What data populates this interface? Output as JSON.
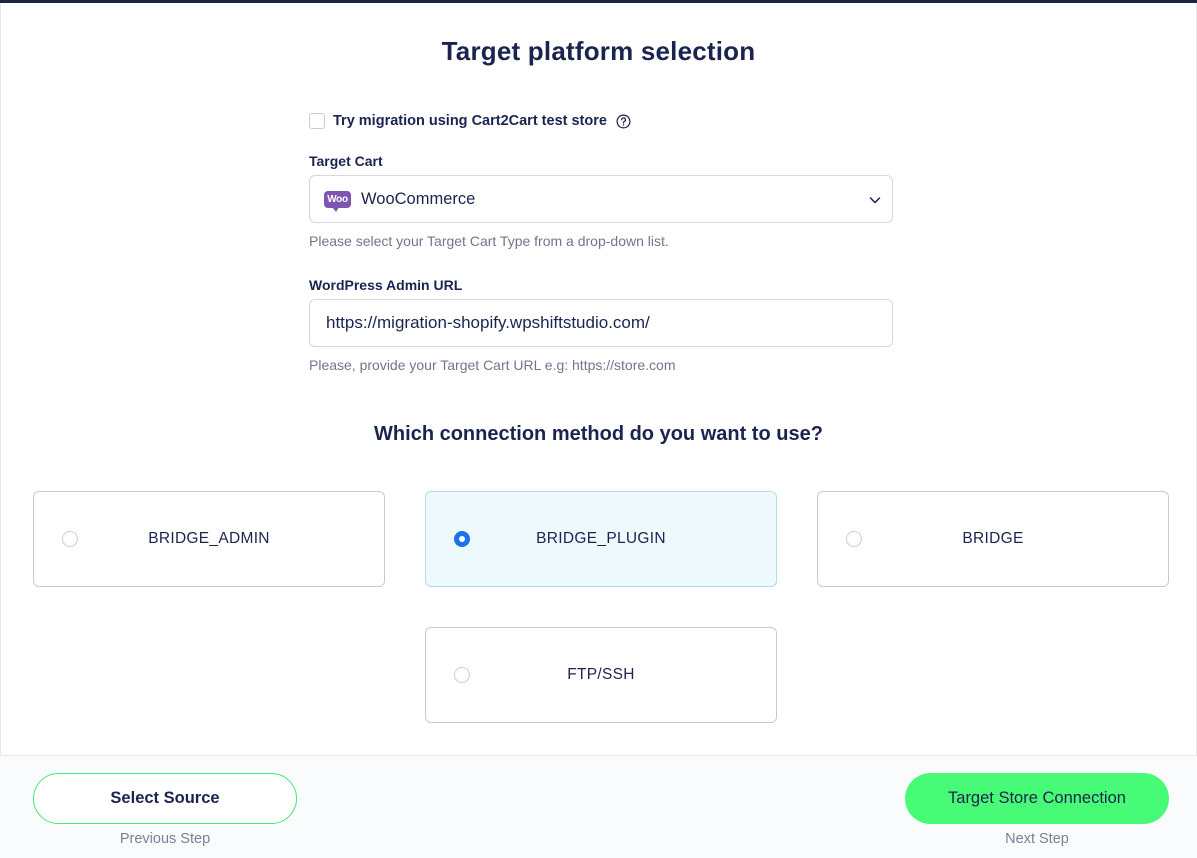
{
  "page": {
    "title": "Target platform selection"
  },
  "test_store": {
    "label": "Try migration using Cart2Cart test store",
    "checked": false
  },
  "target_cart": {
    "label": "Target Cart",
    "value": "WooCommerce",
    "logo_text": "Woo",
    "hint": "Please select your Target Cart Type from a drop-down list."
  },
  "admin_url": {
    "label": "WordPress Admin URL",
    "value": "https://migration-shopify.wpshiftstudio.com/",
    "hint": "Please, provide your Target Cart URL e.g: https://store.com"
  },
  "connection": {
    "title": "Which connection method do you want to use?",
    "options": [
      {
        "label": "BRIDGE_ADMIN",
        "selected": false
      },
      {
        "label": "BRIDGE_PLUGIN",
        "selected": true
      },
      {
        "label": "BRIDGE",
        "selected": false
      },
      {
        "label": "FTP/SSH",
        "selected": false
      }
    ]
  },
  "footer": {
    "prev_button": "Select Source",
    "prev_hint": "Previous Step",
    "next_button": "Target Store Connection",
    "next_hint": "Next Step"
  },
  "colors": {
    "primary_text": "#1b2450",
    "accent_green": "#48fb76",
    "radio_selected": "#1a73e8",
    "selected_option_bg": "#eef9fd",
    "woo_purple": "#7f54b3"
  }
}
